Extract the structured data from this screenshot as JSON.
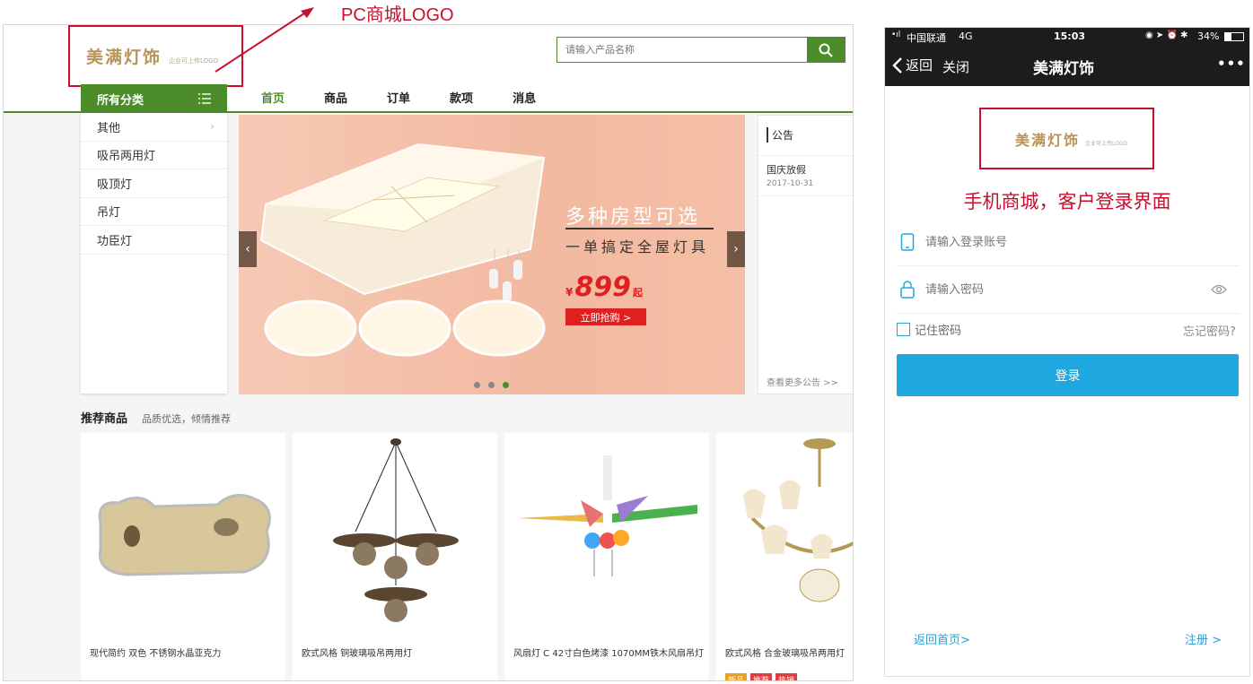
{
  "annotations": {
    "pc_logo": "PC商城LOGO",
    "mobile": "手机商城，客户登录界面"
  },
  "pc": {
    "logo_text": "美满灯饰",
    "logo_sub": "企业可上传LOGO",
    "search_placeholder": "请输入产品名称",
    "nav": [
      "首页",
      "商品",
      "订单",
      "款项",
      "消息"
    ],
    "categories_title": "所有分类",
    "categories": [
      "其他",
      "吸吊两用灯",
      "吸顶灯",
      "吊灯",
      "功臣灯"
    ],
    "banner": {
      "headline": "多种房型可选",
      "subline": "一单搞定全屋灯具",
      "currency": "¥",
      "price": "899",
      "price_suffix": "起",
      "cta": "立即抢购 >"
    },
    "notice": {
      "title": "公告",
      "item_title": "国庆放假",
      "item_date": "2017-10-31",
      "more": "查看更多公告 >>"
    },
    "recommend_title": "推荐商品",
    "recommend_sub": "品质优选，倾情推荐",
    "products": [
      {
        "name": "现代简约 双色 不锈钢水晶亚克力"
      },
      {
        "name": "欧式风格 铜玻璃吸吊两用灯"
      },
      {
        "name": "风扇灯 C 42寸白色烤漆 1070MM铁木风扇吊灯"
      },
      {
        "name": "欧式风格 合金玻璃吸吊两用灯"
      }
    ],
    "tags": [
      "新品",
      "推荐",
      "热销"
    ]
  },
  "phone": {
    "status": {
      "carrier": "中国联通",
      "network": "4G",
      "time": "15:03",
      "battery": "34%"
    },
    "back": "返回",
    "close": "关闭",
    "title": "美满灯饰",
    "more": "•••",
    "logo_text": "美满灯饰",
    "logo_sub": "企业可上传LOGO",
    "account_placeholder": "请输入登录账号",
    "password_placeholder": "请输入密码",
    "remember": "记住密码",
    "forgot": "忘记密码?",
    "login": "登录",
    "back_home": "返回首页>",
    "register": "注册 >"
  },
  "colors": {
    "brand_green": "#4c8c2a",
    "accent_red": "#c8102e",
    "login_blue": "#1fa8e0",
    "link_blue": "#2a9fd6"
  }
}
